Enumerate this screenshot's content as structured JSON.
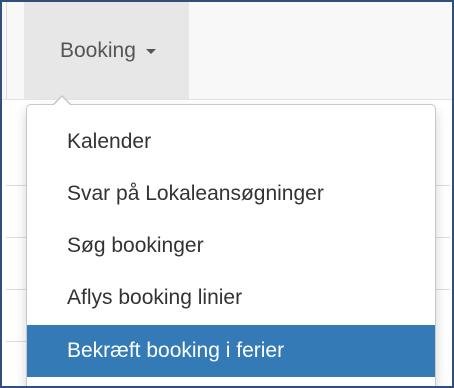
{
  "navbar": {
    "booking_label": "Booking"
  },
  "menu": {
    "items": [
      {
        "label": "Kalender"
      },
      {
        "label": "Svar på Lokaleansøgninger"
      },
      {
        "label": "Søg bookinger"
      },
      {
        "label": "Aflys booking linier"
      },
      {
        "label": "Bekræft booking i ferier"
      }
    ],
    "active_index": 4
  },
  "colors": {
    "frame_border": "#2f4f7f",
    "active_bg": "#337ab7",
    "navbar_bg": "#f8f8f8",
    "nav_item_bg": "#e7e7e7"
  }
}
